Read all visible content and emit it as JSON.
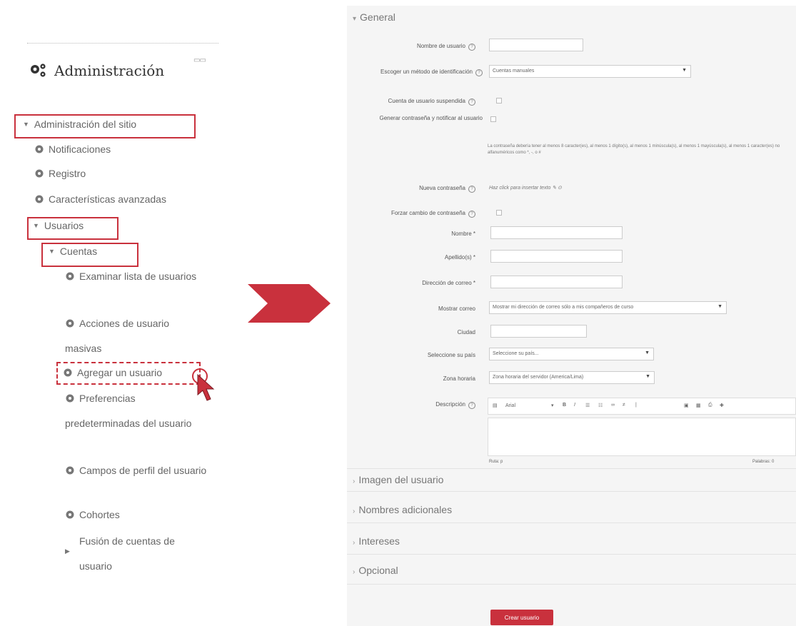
{
  "admin": {
    "title": "Administración",
    "block_tools": "▭▭",
    "items": [
      {
        "label": "Administración del sitio",
        "icon": "caret-down-icon"
      },
      {
        "label": "Notificaciones",
        "icon": "gear-icon"
      },
      {
        "label": "Registro",
        "icon": "gear-icon"
      },
      {
        "label": "Características avanzadas",
        "icon": "gear-icon"
      },
      {
        "label": "Usuarios",
        "icon": "caret-down-icon"
      },
      {
        "label": "Cuentas",
        "icon": "caret-down-icon"
      },
      {
        "label": "Examinar lista de usuarios",
        "icon": "gear-icon"
      },
      {
        "label": "Acciones de usuario masivas",
        "icon": "gear-icon"
      },
      {
        "label": "Agregar un usuario",
        "icon": "gear-icon"
      },
      {
        "label": "Preferencias predeterminadas del usuario",
        "icon": "gear-icon"
      },
      {
        "label": "Campos de perfil del usuario",
        "icon": "gear-icon"
      },
      {
        "label": "Cohortes",
        "icon": "gear-icon"
      },
      {
        "label": "Fusión de cuentas de usuario",
        "icon": "caret-right-icon"
      }
    ]
  },
  "form": {
    "section_general": "General",
    "fields": {
      "username": "Nombre de usuario",
      "auth_method": "Escoger un método de identificación",
      "auth_method_value": "Cuentas manuales",
      "suspended": "Cuenta de usuario suspendida",
      "gen_password": "Generar contraseña y notificar al usuario",
      "password_policy": "La contraseña debería tener al menos 8 caracter(es), al menos 1 dígito(s), al menos 1 minúscula(s), al menos 1 mayúscula(s), al menos 1 caracter(es) no alfanuméricos como *, -, o #",
      "new_password": "Nueva contraseña",
      "new_password_hint": "Haz click para insertar texto",
      "force_change": "Forzar cambio de contraseña",
      "firstname": "Nombre",
      "lastname": "Apellido(s)",
      "email": "Dirección de correo",
      "show_email": "Mostrar correo",
      "show_email_value": "Mostrar mi dirección de correo sólo a mis compañeros de curso",
      "city": "Ciudad",
      "country": "Seleccione su país",
      "country_value": "Seleccione su país...",
      "timezone": "Zona horaria",
      "timezone_value": "Zona horaria del servidor (America/Lima)",
      "description": "Descripción",
      "editor_font": "Arial",
      "editor_path": "Ruta: p",
      "editor_words": "Palabras: 0"
    },
    "collapsed_sections": [
      "Imagen del usuario",
      "Nombres adicionales",
      "Intereses",
      "Opcional"
    ],
    "submit_label": "Crear usuario"
  },
  "colors": {
    "accent_red": "#c9313d",
    "panel_bg": "#f5f5f5"
  }
}
